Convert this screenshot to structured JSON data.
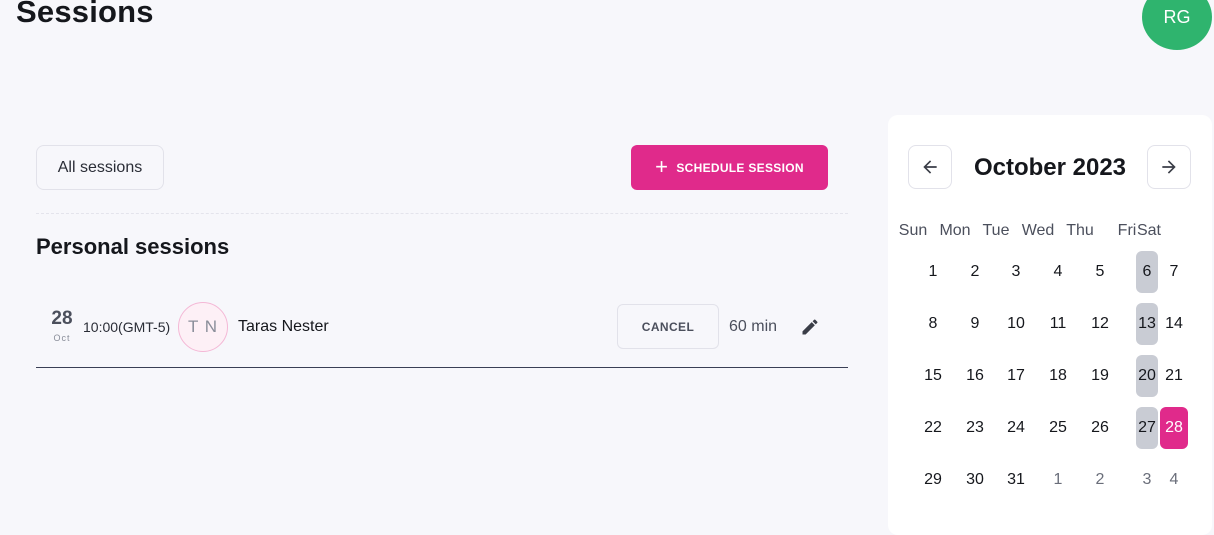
{
  "page": {
    "title": "Sessions"
  },
  "user": {
    "initials": "RG"
  },
  "toolbar": {
    "filter_label": "All sessions",
    "schedule_label": "SCHEDULE SESSION"
  },
  "section": {
    "title": "Personal sessions"
  },
  "session": {
    "day": "28",
    "month": "Oct",
    "time": "10:00(GMT-5)",
    "client_initials": "T N",
    "client_name": "Taras Nester",
    "cancel_label": "CANCEL",
    "duration": "60 min"
  },
  "calendar": {
    "title": "October 2023",
    "weekdays": [
      "Sun",
      "Mon",
      "Tue",
      "Wed",
      "Thu",
      "Fri",
      "Sat"
    ],
    "weeks": [
      [
        "1",
        "2",
        "3",
        "4",
        "5",
        "6",
        "7"
      ],
      [
        "8",
        "9",
        "10",
        "11",
        "12",
        "13",
        "14"
      ],
      [
        "15",
        "16",
        "17",
        "18",
        "19",
        "20",
        "21"
      ],
      [
        "22",
        "23",
        "24",
        "25",
        "26",
        "27",
        "28"
      ],
      [
        "29",
        "30",
        "31",
        "1",
        "2",
        "3",
        "4"
      ]
    ],
    "selected_day": "28"
  },
  "colors": {
    "accent": "#e02a8b",
    "avatar": "#2fb46e",
    "friday_highlight": "#c9ccd4"
  }
}
